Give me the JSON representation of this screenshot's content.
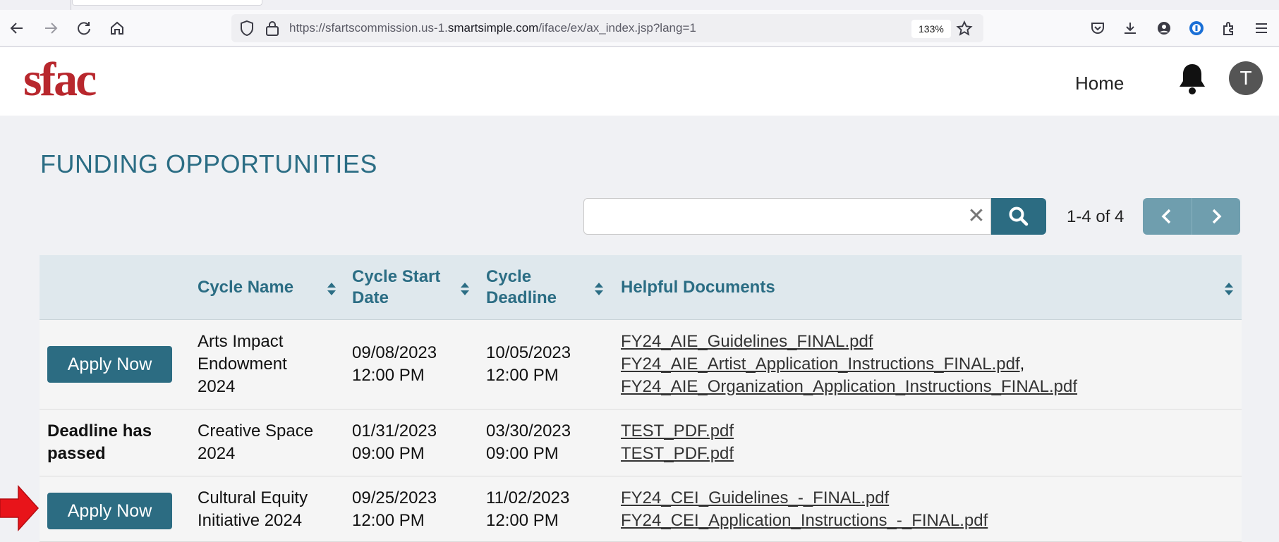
{
  "browser": {
    "url_prefix": "https://sfartscommission.us-1.",
    "url_domain": "smartsimple.com",
    "url_path": "/iface/ex/ax_index.jsp?lang=1",
    "zoom": "133%"
  },
  "header": {
    "logo": "sfac",
    "home_link": "Home",
    "avatar_initial": "T"
  },
  "main": {
    "title": "FUNDING OPPORTUNITIES",
    "search": {
      "value": "",
      "placeholder": ""
    },
    "pager": {
      "count": "1-4 of 4"
    }
  },
  "table": {
    "headers": [
      "",
      "Cycle Name",
      "Cycle Start Date",
      "Cycle Deadline",
      "Helpful Documents"
    ],
    "header_lines": {
      "name": "Cycle Name",
      "start_1": "Cycle Start",
      "start_2": "Date",
      "deadline_1": "Cycle",
      "deadline_2": "Deadline",
      "docs": "Helpful Documents"
    },
    "rows": [
      {
        "action": "Apply Now",
        "name": [
          "Arts Impact",
          "Endowment",
          "2024"
        ],
        "start": [
          "09/08/2023",
          "12:00 PM"
        ],
        "deadline": [
          "10/05/2023",
          "12:00 PM"
        ],
        "docs": [
          "FY24_AIE_Guidelines_FINAL.pdf",
          "FY24_AIE_Artist_Application_Instructions_FINAL.pdf",
          "FY24_AIE_Organization_Application_Instructions_FINAL.pdf"
        ],
        "doc_separator": ","
      },
      {
        "action": "Deadline has passed",
        "action_lines": [
          "Deadline has",
          "passed"
        ],
        "name": [
          "Creative Space",
          "2024"
        ],
        "start": [
          "01/31/2023",
          "09:00 PM"
        ],
        "deadline": [
          "03/30/2023",
          "09:00 PM"
        ],
        "docs": [
          "TEST_PDF.pdf",
          "TEST_PDF.pdf"
        ]
      },
      {
        "action": "Apply Now",
        "name": [
          "Cultural Equity",
          "Initiative 2024"
        ],
        "start": [
          "09/25/2023",
          "12:00 PM"
        ],
        "deadline": [
          "11/02/2023",
          "12:00 PM"
        ],
        "docs": [
          "FY24_CEI_Guidelines_-_FINAL.pdf",
          "FY24_CEI_Application_Instructions_-_FINAL.pdf"
        ]
      }
    ]
  },
  "colors": {
    "brand_red": "#b8272d",
    "accent_teal": "#2c6c82",
    "header_text": "#2b6d84",
    "annotation_arrow": "#e8141a"
  }
}
